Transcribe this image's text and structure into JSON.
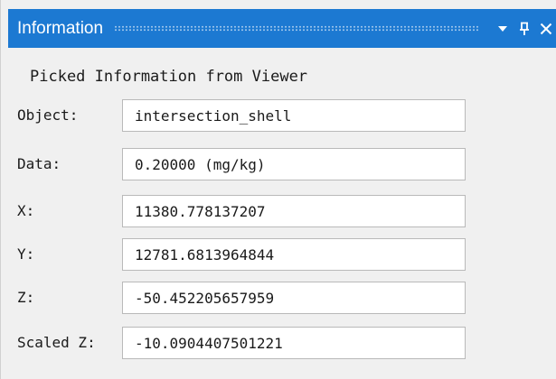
{
  "window": {
    "title": "Information",
    "buttons": [
      "dropdown-arrow-icon",
      "pin-icon",
      "close-icon"
    ]
  },
  "panel": {
    "heading": "Picked Information from Viewer",
    "fields": [
      {
        "label": "Object:",
        "value": "intersection_shell"
      },
      {
        "label": "Data:",
        "value": "0.20000 (mg/kg)"
      },
      {
        "label": "X:",
        "value": "11380.778137207"
      },
      {
        "label": "Y:",
        "value": "12781.6813964844"
      },
      {
        "label": "Z:",
        "value": "-50.452205657959"
      },
      {
        "label": "Scaled Z:",
        "value": "-10.0904407501221"
      }
    ]
  },
  "colors": {
    "titlebar": "#1c79d2",
    "background": "#f0f0f0",
    "field_background": "#ffffff",
    "field_border": "#b9b9b9"
  }
}
